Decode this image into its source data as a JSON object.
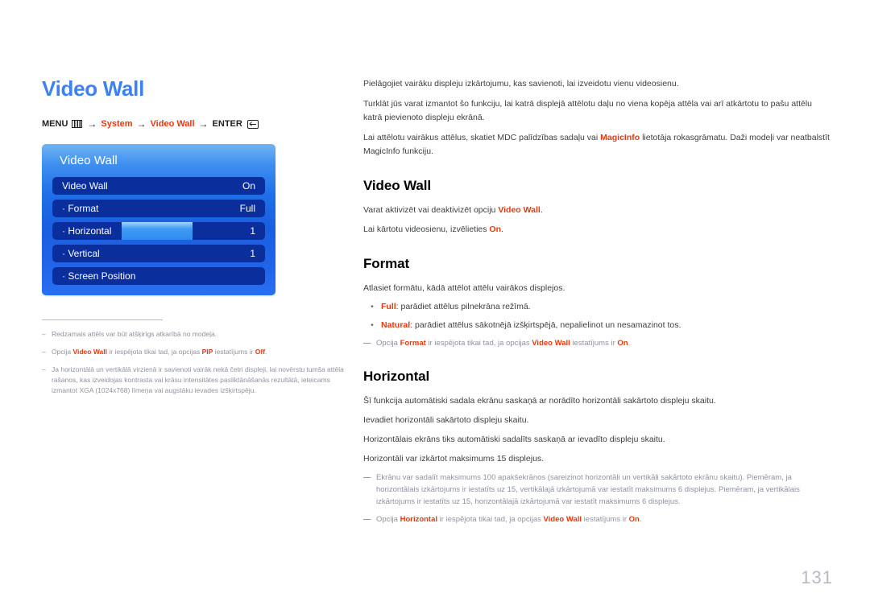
{
  "document": {
    "page_number": "131"
  },
  "left": {
    "title": "Video Wall",
    "menu_path": {
      "menu_label": "MENU",
      "menu_icon": "menu-grid-icon",
      "arrow": "→",
      "step1": "System",
      "step2": "Video Wall",
      "enter_label": "ENTER",
      "enter_icon": "enter-return-icon"
    },
    "osd": {
      "header": "Video Wall",
      "rows": [
        {
          "label": "Video Wall",
          "value": "On",
          "slider": false
        },
        {
          "label": "· Format",
          "value": "Full",
          "slider": false
        },
        {
          "label": "· Horizontal",
          "value": "1",
          "slider": true
        },
        {
          "label": "· Vertical",
          "value": "1",
          "slider": false
        },
        {
          "label": "· Screen Position",
          "value": "",
          "slider": false
        }
      ]
    },
    "footnotes": [
      {
        "dash": "–",
        "parts": [
          {
            "t": "Redzamais attēls var būt atšķirīgs atkarībā no modeļa.",
            "red": false
          }
        ]
      },
      {
        "dash": "–",
        "parts": [
          {
            "t": "Opcija ",
            "red": false
          },
          {
            "t": "Video Wall",
            "red": true
          },
          {
            "t": " ir iespējota tikai tad, ja opcijas ",
            "red": false
          },
          {
            "t": "PIP",
            "red": true
          },
          {
            "t": " iestatījums ir ",
            "red": false
          },
          {
            "t": "Off",
            "red": true
          },
          {
            "t": ".",
            "red": false
          }
        ]
      },
      {
        "dash": "–",
        "parts": [
          {
            "t": "Ja horizontālā un vertikālā virzienā ir savienoti vairāk nekā četri displeji, lai novērstu tumša attēla rašanos, kas izveidojas kontrasta vai krāsu intensitātes pasliktānāšanās rezultātā, ieteicams izmantot XGA (1024x768) līmeņa vai augstāku ievades izšķirtspēju.",
            "red": false
          }
        ]
      }
    ]
  },
  "right": {
    "intro": [
      [
        {
          "t": "Pielāgojiet vairāku displeju izkārtojumu, kas savienoti, lai izveidotu vienu videosienu.",
          "red": false
        }
      ],
      [
        {
          "t": "Turklāt jūs varat izmantot šo funkciju, lai katrā displejā attēlotu daļu no viena kopēja attēla vai arī atkārtotu to pašu attēlu katrā pievienoto displeju ekrānā.",
          "red": false
        }
      ],
      [
        {
          "t": "Lai attēlotu vairākus attēlus, skatiet MDC palīdzības sadaļu vai ",
          "red": false
        },
        {
          "t": "MagicInfo",
          "red": true
        },
        {
          "t": " lietotāja rokasgrāmatu. Daži modeļi var neatbalstīt MagicInfo funkciju.",
          "red": false
        }
      ]
    ],
    "sections": [
      {
        "heading": "Video Wall",
        "lines": [
          [
            {
              "t": "Varat aktivizēt vai deaktivizēt opciju ",
              "red": false
            },
            {
              "t": "Video Wall",
              "red": true
            },
            {
              "t": ".",
              "red": false
            }
          ],
          [
            {
              "t": "Lai kārtotu videosienu, izvēlieties ",
              "red": false
            },
            {
              "t": "On",
              "red": true
            },
            {
              "t": ".",
              "red": false
            }
          ]
        ],
        "bullets": [],
        "notes": []
      },
      {
        "heading": "Format",
        "lines": [
          [
            {
              "t": "Atlasiet formātu, kādā attēlot attēlu vairākos displejos.",
              "red": false
            }
          ]
        ],
        "bullets": [
          [
            {
              "t": "Full",
              "red": true
            },
            {
              "t": ": parādiet attēlus pilnekrāna režīmā.",
              "red": false
            }
          ],
          [
            {
              "t": "Natural",
              "red": true
            },
            {
              "t": ": parādiet attēlus sākotnējā izšķirtspējā, nepalielinot un nesamazinot tos.",
              "red": false
            }
          ]
        ],
        "notes": [
          {
            "dash": "—",
            "indent": false,
            "parts": [
              {
                "t": "Opcija ",
                "red": false
              },
              {
                "t": "Format",
                "red": true
              },
              {
                "t": " ir iespējota tikai tad, ja opcijas ",
                "red": false
              },
              {
                "t": "Video Wall",
                "red": true
              },
              {
                "t": " iestatījums ir ",
                "red": false
              },
              {
                "t": "On",
                "red": true
              },
              {
                "t": ".",
                "red": false
              }
            ]
          }
        ]
      },
      {
        "heading": "Horizontal",
        "lines": [
          [
            {
              "t": "Šī funkcija automātiski sadala ekrānu saskaņā ar norādīto horizontāli sakārtoto displeju skaitu.",
              "red": false
            }
          ],
          [
            {
              "t": "Ievadiet horizontāli sakārtoto displeju skaitu.",
              "red": false
            }
          ],
          [
            {
              "t": "Horizontālais ekrāns tiks automātiski sadalīts saskaņā ar ievadīto displeju skaitu.",
              "red": false
            }
          ],
          [
            {
              "t": "Horizontāli var izkārtot maksimums 15 displejus.",
              "red": false
            }
          ]
        ],
        "bullets": [],
        "notes": [
          {
            "dash": "—",
            "indent": false,
            "parts": [
              {
                "t": "Ekrānu var sadalīt maksimums 100 apakšekrānos (sareizinot horizontāli un vertikāli sakārtoto ekrānu skaitu). Piemēram, ja horizontālais izkārtojums ir iestatīts uz 15, vertikālajā izkārtojumā var iestatīt maksimums 6 displejus. Piemēram, ja vertikālais izkārtojums ir iestatīts uz 15, horizontālajā izkārtojumā var iestatīt maksimums 6 displejus.",
                "red": false
              }
            ]
          },
          {
            "dash": "—",
            "indent": false,
            "parts": [
              {
                "t": "Opcija ",
                "red": false
              },
              {
                "t": "Horizontal",
                "red": true
              },
              {
                "t": " ir iespējota tikai tad, ja opcijas ",
                "red": false
              },
              {
                "t": "Video Wall",
                "red": true
              },
              {
                "t": " iestatījums ir ",
                "red": false
              },
              {
                "t": "On",
                "red": true
              },
              {
                "t": ".",
                "red": false
              }
            ]
          }
        ]
      }
    ]
  },
  "colors": {
    "accent_blue": "#3c82f0",
    "accent_red": "#e8380d",
    "osd_row": "#0a2f9c",
    "muted": "#8e93a1"
  }
}
